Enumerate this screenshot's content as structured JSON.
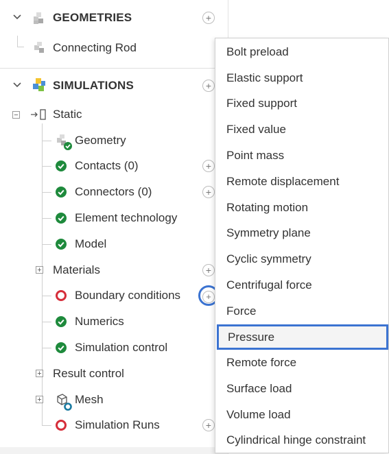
{
  "geometries": {
    "title": "GEOMETRIES",
    "items": [
      {
        "label": "Connecting Rod"
      }
    ]
  },
  "simulations": {
    "title": "SIMULATIONS",
    "static": {
      "label": "Static",
      "prefix_glyph": "→⃞",
      "children": [
        {
          "label": "Geometry",
          "status": "geometry-ok"
        },
        {
          "label": "Contacts (0)",
          "status": "ok",
          "addable": true
        },
        {
          "label": "Connectors (0)",
          "status": "ok",
          "addable": true
        },
        {
          "label": "Element technology",
          "status": "ok"
        },
        {
          "label": "Model",
          "status": "ok"
        },
        {
          "label": "Materials",
          "status": "collapsed",
          "addable": true
        },
        {
          "label": "Boundary conditions",
          "status": "error",
          "addable": true
        },
        {
          "label": "Numerics",
          "status": "ok"
        },
        {
          "label": "Simulation control",
          "status": "ok"
        },
        {
          "label": "Result control",
          "status": "collapsed"
        },
        {
          "label": "Mesh",
          "status": "mesh"
        },
        {
          "label": "Simulation Runs",
          "status": "error",
          "addable": true
        }
      ]
    }
  },
  "glyphs": {
    "plus": "+",
    "minus": "−",
    "chevron": "⌄"
  },
  "context_menu": {
    "items": [
      {
        "label": "Bolt preload"
      },
      {
        "label": "Elastic support"
      },
      {
        "label": "Fixed support"
      },
      {
        "label": "Fixed value"
      },
      {
        "label": "Point mass"
      },
      {
        "label": "Remote displacement"
      },
      {
        "label": "Rotating motion"
      },
      {
        "label": "Symmetry plane"
      },
      {
        "label": "Cyclic symmetry"
      },
      {
        "label": "Centrifugal force"
      },
      {
        "label": "Force"
      },
      {
        "label": "Pressure"
      },
      {
        "label": "Remote force"
      },
      {
        "label": "Surface load"
      },
      {
        "label": "Volume load"
      },
      {
        "label": "Cylindrical hinge constraint"
      }
    ],
    "highlighted_index": 11
  },
  "colors": {
    "ok": "#1e8a3c",
    "error": "#d62e3a",
    "focus": "#3b73d1",
    "sim_icon": [
      "#f4c430",
      "#4a8fd8",
      "#7cc242"
    ]
  }
}
